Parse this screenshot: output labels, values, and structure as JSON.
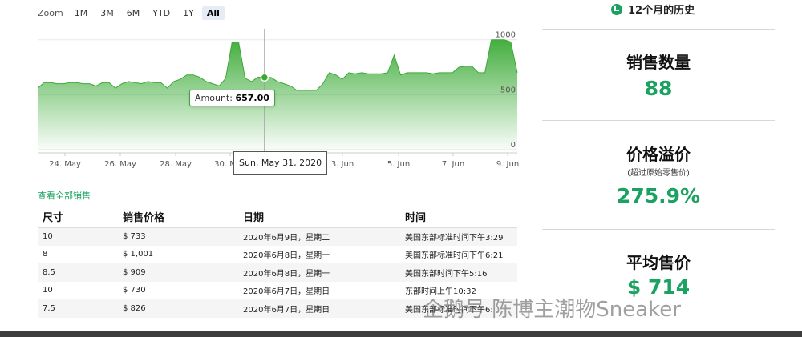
{
  "zoom": {
    "label": "Zoom",
    "buttons": [
      "1M",
      "3M",
      "6M",
      "YTD",
      "1Y",
      "All"
    ],
    "active": "All"
  },
  "chart_data": {
    "type": "area",
    "x_ticks": [
      "24. May",
      "26. May",
      "28. May",
      "30. May",
      "3. Jun",
      "5. Jun",
      "7. Jun",
      "9. Jun"
    ],
    "y_ticks": [
      0,
      500,
      1000
    ],
    "ylim": [
      0,
      1100
    ],
    "color": "#3aaa35",
    "values": [
      560,
      610,
      610,
      600,
      600,
      610,
      610,
      600,
      600,
      580,
      610,
      610,
      560,
      600,
      620,
      610,
      600,
      620,
      610,
      610,
      560,
      620,
      640,
      680,
      680,
      660,
      620,
      600,
      580,
      650,
      980,
      980,
      650,
      620,
      660,
      657,
      657,
      620,
      600,
      580,
      540,
      540,
      540,
      540,
      600,
      700,
      680,
      640,
      700,
      690,
      700,
      690,
      690,
      690,
      700,
      860,
      680,
      700,
      700,
      700,
      700,
      690,
      700,
      700,
      700,
      750,
      760,
      760,
      700,
      700,
      1000,
      1000,
      1000,
      980,
      700
    ],
    "tooltip_label": "Amount:",
    "tooltip_value": "657.00",
    "selected_date": "Sun, May 31, 2020"
  },
  "sales_link": "查看全部销售",
  "table": {
    "headers": [
      "尺寸",
      "销售价格",
      "日期",
      "时间"
    ],
    "rows": [
      [
        "10",
        "$ 733",
        "2020年6月9日，星期二",
        "美国东部标准时间下午3:29"
      ],
      [
        "8",
        "$ 1,001",
        "2020年6月8日，星期一",
        "美国东部标准时间下午6:21"
      ],
      [
        "8.5",
        "$ 909",
        "2020年6月8日，星期一",
        "美国东部时间下午5:16"
      ],
      [
        "10",
        "$ 730",
        "2020年6月7日，星期日",
        "东部时间上午10:32"
      ],
      [
        "7.5",
        "$ 826",
        "2020年6月7日，星期日",
        "美国东部标准时间下午6:"
      ]
    ]
  },
  "stats": {
    "history_title": "12个月的历史",
    "sales_count_label": "销售数量",
    "sales_count_value": "88",
    "premium_label": "价格溢价",
    "premium_sub": "(超过原始零售价)",
    "premium_value": "275.9%",
    "avg_price_label": "平均售价",
    "avg_price_value": "$ 714"
  },
  "watermark": "企鹅号 陈博主潮物Sneaker"
}
